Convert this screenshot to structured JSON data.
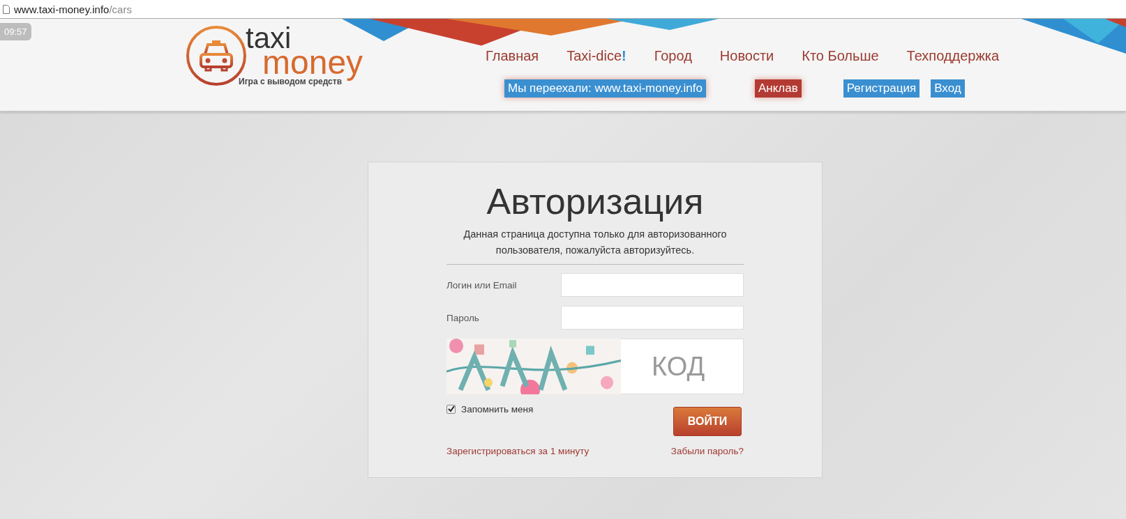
{
  "address_bar": {
    "host": "www.taxi-money.info",
    "path": "/cars"
  },
  "clock": "09:57",
  "logo": {
    "word_1": "taxi",
    "word_2": "money",
    "tagline": "Игра с выводом средств"
  },
  "nav": [
    {
      "label": "Главная"
    },
    {
      "label": "Taxi-dice",
      "badge": "!"
    },
    {
      "label": "Город"
    },
    {
      "label": "Новости"
    },
    {
      "label": "Кто Больше"
    },
    {
      "label": "Техподдержка"
    }
  ],
  "header_buttons": [
    {
      "label": "Мы переехали: www.taxi-money.info",
      "kind": "notice"
    },
    {
      "label": "Анклав",
      "kind": "danger"
    },
    {
      "label": "Регистрация",
      "kind": "primary"
    },
    {
      "label": "Вход",
      "kind": "primary"
    }
  ],
  "login": {
    "title": "Авторизация",
    "description": "Данная страница доступна только для авторизованного пользователя, пожалуйста авторизуйтесь.",
    "fields": [
      {
        "label": "Логин или Email"
      },
      {
        "label": "Пароль"
      }
    ],
    "captcha": {
      "kind": "picture",
      "placeholder": "КОД"
    },
    "remember": {
      "label": "Запомнить меня",
      "checked": true
    },
    "submit": "ВОЙТИ",
    "register_link": "Зарегистрироваться за 1 минуту",
    "forgot_link": "Забыли пароль?"
  }
}
